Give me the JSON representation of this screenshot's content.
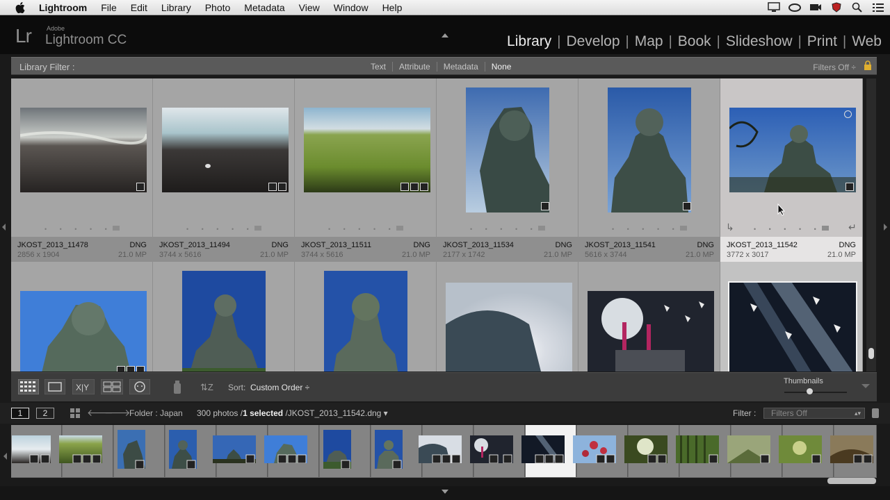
{
  "menubar": {
    "app_name": "Lightroom",
    "items": [
      "File",
      "Edit",
      "Library",
      "Photo",
      "Metadata",
      "View",
      "Window",
      "Help"
    ]
  },
  "app": {
    "logo": "Lr",
    "brand_top": "Adobe",
    "brand_name": "Lightroom CC"
  },
  "modules": [
    "Library",
    "Develop",
    "Map",
    "Book",
    "Slideshow",
    "Print",
    "Web"
  ],
  "active_module": "Library",
  "library_filter": {
    "title": "Library Filter :",
    "options": [
      "Text",
      "Attribute",
      "Metadata",
      "None"
    ],
    "selected": "None",
    "preset": "Filters Off"
  },
  "grid": {
    "row1": [
      {
        "name": "JKOST_2013_11478",
        "type": "DNG",
        "dims": "2856 x 1904",
        "mp": "21.0 MP",
        "selected": false
      },
      {
        "name": "JKOST_2013_11494",
        "type": "DNG",
        "dims": "3744 x 5616",
        "mp": "21.0 MP",
        "selected": false
      },
      {
        "name": "JKOST_2013_11511",
        "type": "DNG",
        "dims": "3744 x 5616",
        "mp": "21.0 MP",
        "selected": false
      },
      {
        "name": "JKOST_2013_11534",
        "type": "DNG",
        "dims": "2177 x 1742",
        "mp": "21.0 MP",
        "selected": false
      },
      {
        "name": "JKOST_2013_11541",
        "type": "DNG",
        "dims": "5616 x 3744",
        "mp": "21.0 MP",
        "selected": false
      },
      {
        "name": "JKOST_2013_11542",
        "type": "DNG",
        "dims": "3772 x 3017",
        "mp": "21.0 MP",
        "selected": true
      }
    ],
    "dots": "• • • • •"
  },
  "toolbar": {
    "sort_label": "Sort:",
    "sort_value": "Custom Order ÷",
    "thumbnails_label": "Thumbnails",
    "thumbnail_size": 0.35
  },
  "filmstrip_header": {
    "page1": "1",
    "page2": "2",
    "folder": "Folder : Japan",
    "count": "300 photos /",
    "selected": "1 selected",
    "file": "/JKOST_2013_11542.dng ▾",
    "filter_label": "Filter :",
    "filter_value": "Filters Off"
  },
  "filmstrip": {
    "count": 17,
    "selected_index": 10
  },
  "colors": {
    "panel": "#1a1a1a",
    "grid_cell": "#a5a5a5",
    "selected_cell": "#c9c6c6"
  }
}
